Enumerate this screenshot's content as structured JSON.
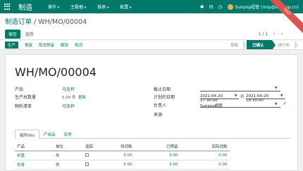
{
  "topbar": {
    "app_name": "制造",
    "menu": [
      "操作",
      "主数据",
      "报表",
      "配置"
    ],
    "user": "Sunpop超管 (mrp@sunpop.cn)"
  },
  "ribbon": "TEST",
  "breadcrumb": {
    "parent": "制造订单",
    "separator": "/",
    "current": "WH/MO/00004"
  },
  "control": {
    "save": "保存",
    "discard": "放弃",
    "pager": "1 / 1"
  },
  "statusbar": {
    "primary": "生产",
    "buttons": [
      "报废",
      "取消预留",
      "解锁",
      "取消"
    ],
    "stages": [
      "草稿",
      "已确认",
      "进行中"
    ],
    "active_stage": "已确认"
  },
  "form": {
    "name": "WH/MO/00004",
    "product_label": "产品",
    "product": "马克杯",
    "qty_label": "生产总数量",
    "qty": "5.00 件",
    "update": "更新",
    "bom_label": "物料清单",
    "bom": "马克杯",
    "deadline_label": "截止日期",
    "planned_label": "计划的日期",
    "date_from": "2021-04-20 17:30:00",
    "to": "到",
    "date_to": "2021-04-20 18:30:00",
    "responsible_label": "负责人",
    "responsible": "Sunpop超管",
    "source_label": "来源"
  },
  "tabs": [
    "组件Sku",
    "产成品",
    "杂项"
  ],
  "table": {
    "headers": [
      "产品",
      "单位",
      "追踪",
      "待消耗",
      "已预留",
      "实际消耗"
    ],
    "rows": [
      {
        "product": "杯盖",
        "uom": "件",
        "to_consume": "5.00",
        "reserved": "5.00",
        "consumed": "0.00"
      },
      {
        "product": "杯身",
        "uom": "件",
        "to_consume": "5.00",
        "reserved": "5.00",
        "consumed": "0.00"
      }
    ]
  }
}
